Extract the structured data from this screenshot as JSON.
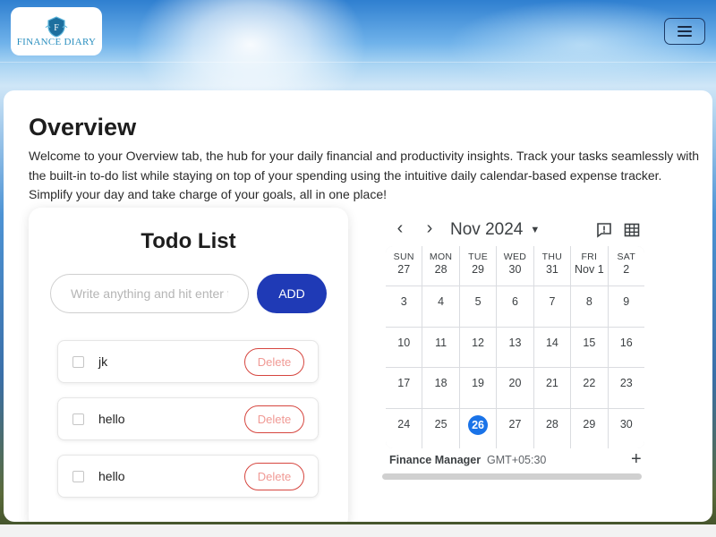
{
  "brand": {
    "name": "FINANCE DIARY"
  },
  "navbar": {
    "menu_icon": "hamburger-icon"
  },
  "overview": {
    "title": "Overview",
    "intro": "Welcome to your Overview tab, the hub for your daily financial and productivity insights. Track your tasks seamlessly with the built-in to-do list while staying on top of your spending using the intuitive daily calendar-based expense tracker. Simplify your day and take charge of your goals, all in one place!"
  },
  "todo": {
    "title": "Todo List",
    "placeholder": "Write anything and hit enter to add",
    "add_label": "ADD",
    "items": [
      {
        "label": "jk",
        "checked": false,
        "delete_label": "Delete"
      },
      {
        "label": "hello",
        "checked": false,
        "delete_label": "Delete"
      },
      {
        "label": "hello",
        "checked": false,
        "delete_label": "Delete"
      }
    ]
  },
  "calendar": {
    "prev_icon": "chevron-left-icon",
    "next_icon": "chevron-right-icon",
    "month_label": "Nov 2024",
    "feedback_icon": "feedback-icon",
    "view_icon": "grid-view-icon",
    "weekdays": [
      "SUN",
      "MON",
      "TUE",
      "WED",
      "THU",
      "FRI",
      "SAT"
    ],
    "weeks": [
      [
        "27",
        "28",
        "29",
        "30",
        "31",
        "Nov 1",
        "2"
      ],
      [
        "3",
        "4",
        "5",
        "6",
        "7",
        "8",
        "9"
      ],
      [
        "10",
        "11",
        "12",
        "13",
        "14",
        "15",
        "16"
      ],
      [
        "17",
        "18",
        "19",
        "20",
        "21",
        "22",
        "23"
      ],
      [
        "24",
        "25",
        "26",
        "27",
        "28",
        "29",
        "30"
      ]
    ],
    "today": "26",
    "calendar_name": "Finance Manager",
    "timezone": "GMT+05:30",
    "add_icon": "plus-icon",
    "accent_color": "#1a73e8"
  },
  "colors": {
    "add_button": "#1f3ab6",
    "delete_border": "#d6463f",
    "delete_text": "#f09a95"
  }
}
